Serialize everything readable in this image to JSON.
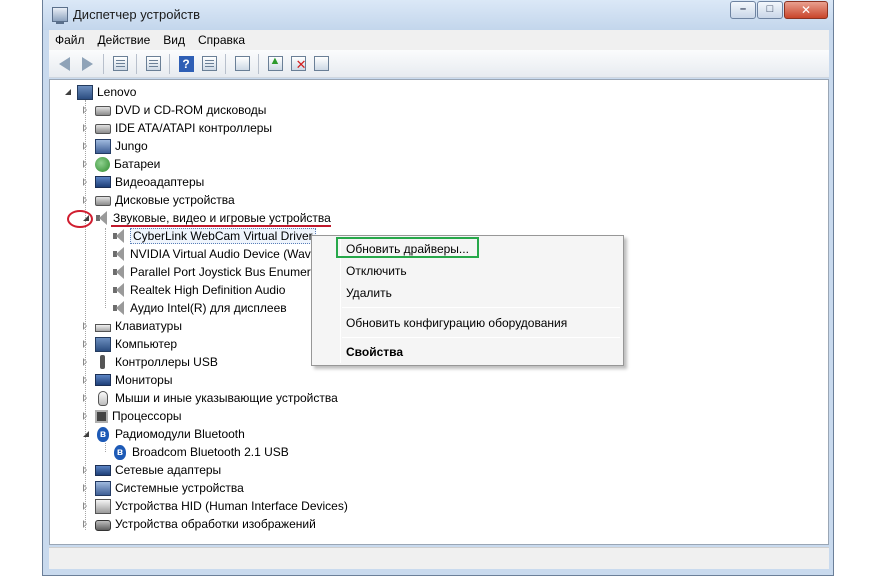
{
  "window": {
    "title": "Диспетчер устройств",
    "minimize_glyph": "–",
    "maximize_glyph": "□",
    "close_glyph": "✕"
  },
  "menu": {
    "items": [
      "Файл",
      "Действие",
      "Вид",
      "Справка"
    ]
  },
  "toolbar": {
    "icons": [
      "back-arrow-icon",
      "forward-arrow-icon",
      "properties-pane-icon",
      "console-tree-icon",
      "help-icon",
      "action-pane-icon",
      "scan-hardware-icon",
      "update-driver-icon",
      "uninstall-icon",
      "disable-icon"
    ],
    "help_glyph": "?"
  },
  "tree": {
    "root": "Lenovo",
    "items": [
      {
        "label": "DVD и CD-ROM дисководы",
        "icon": "disk-drive-icon",
        "state": "collapsed"
      },
      {
        "label": "IDE ATA/ATAPI контроллеры",
        "icon": "ide-controller-icon",
        "state": "collapsed"
      },
      {
        "label": "Jungo",
        "icon": "jungo-icon",
        "state": "collapsed"
      },
      {
        "label": "Батареи",
        "icon": "battery-icon",
        "state": "collapsed"
      },
      {
        "label": "Видеоадаптеры",
        "icon": "display-adapter-icon",
        "state": "collapsed"
      },
      {
        "label": "Дисковые устройства",
        "icon": "disk-icon",
        "state": "collapsed"
      },
      {
        "label": "Звуковые, видео и игровые устройства",
        "icon": "speaker-icon",
        "state": "expanded"
      },
      {
        "label": "Клавиатуры",
        "icon": "keyboard-icon",
        "state": "collapsed"
      },
      {
        "label": "Компьютер",
        "icon": "computer-icon",
        "state": "collapsed"
      },
      {
        "label": "Контроллеры USB",
        "icon": "usb-icon",
        "state": "collapsed"
      },
      {
        "label": "Мониторы",
        "icon": "monitor-icon",
        "state": "collapsed"
      },
      {
        "label": "Мыши и иные указывающие устройства",
        "icon": "mouse-icon",
        "state": "collapsed"
      },
      {
        "label": "Процессоры",
        "icon": "processor-icon",
        "state": "collapsed"
      },
      {
        "label": "Радиомодули Bluetooth",
        "icon": "bluetooth-icon",
        "state": "expanded"
      },
      {
        "label": "Сетевые адаптеры",
        "icon": "network-adapter-icon",
        "state": "collapsed"
      },
      {
        "label": "Системные устройства",
        "icon": "system-device-icon",
        "state": "collapsed"
      },
      {
        "label": "Устройства HID (Human Interface Devices)",
        "icon": "hid-icon",
        "state": "collapsed"
      },
      {
        "label": "Устройства обработки изображений",
        "icon": "imaging-device-icon",
        "state": "collapsed"
      }
    ],
    "sound_children": [
      "CyberLink WebCam Virtual Driver",
      "NVIDIA Virtual Audio Device (Wav",
      "Parallel Port Joystick Bus Enumera",
      "Realtek High Definition Audio",
      "Аудио Intel(R) для дисплеев"
    ],
    "bluetooth_children": [
      "Broadcom Bluetooth 2.1 USB"
    ]
  },
  "context_menu": {
    "items": [
      {
        "label": "Обновить драйверы...",
        "bold": false
      },
      {
        "label": "Отключить",
        "bold": false
      },
      {
        "label": "Удалить",
        "bold": false
      },
      {
        "label": "Обновить конфигурацию оборудования",
        "bold": false
      },
      {
        "label": "Свойства",
        "bold": true
      }
    ]
  },
  "colors": {
    "annotation_red": "#c0182b",
    "annotation_green": "#27a84a"
  }
}
